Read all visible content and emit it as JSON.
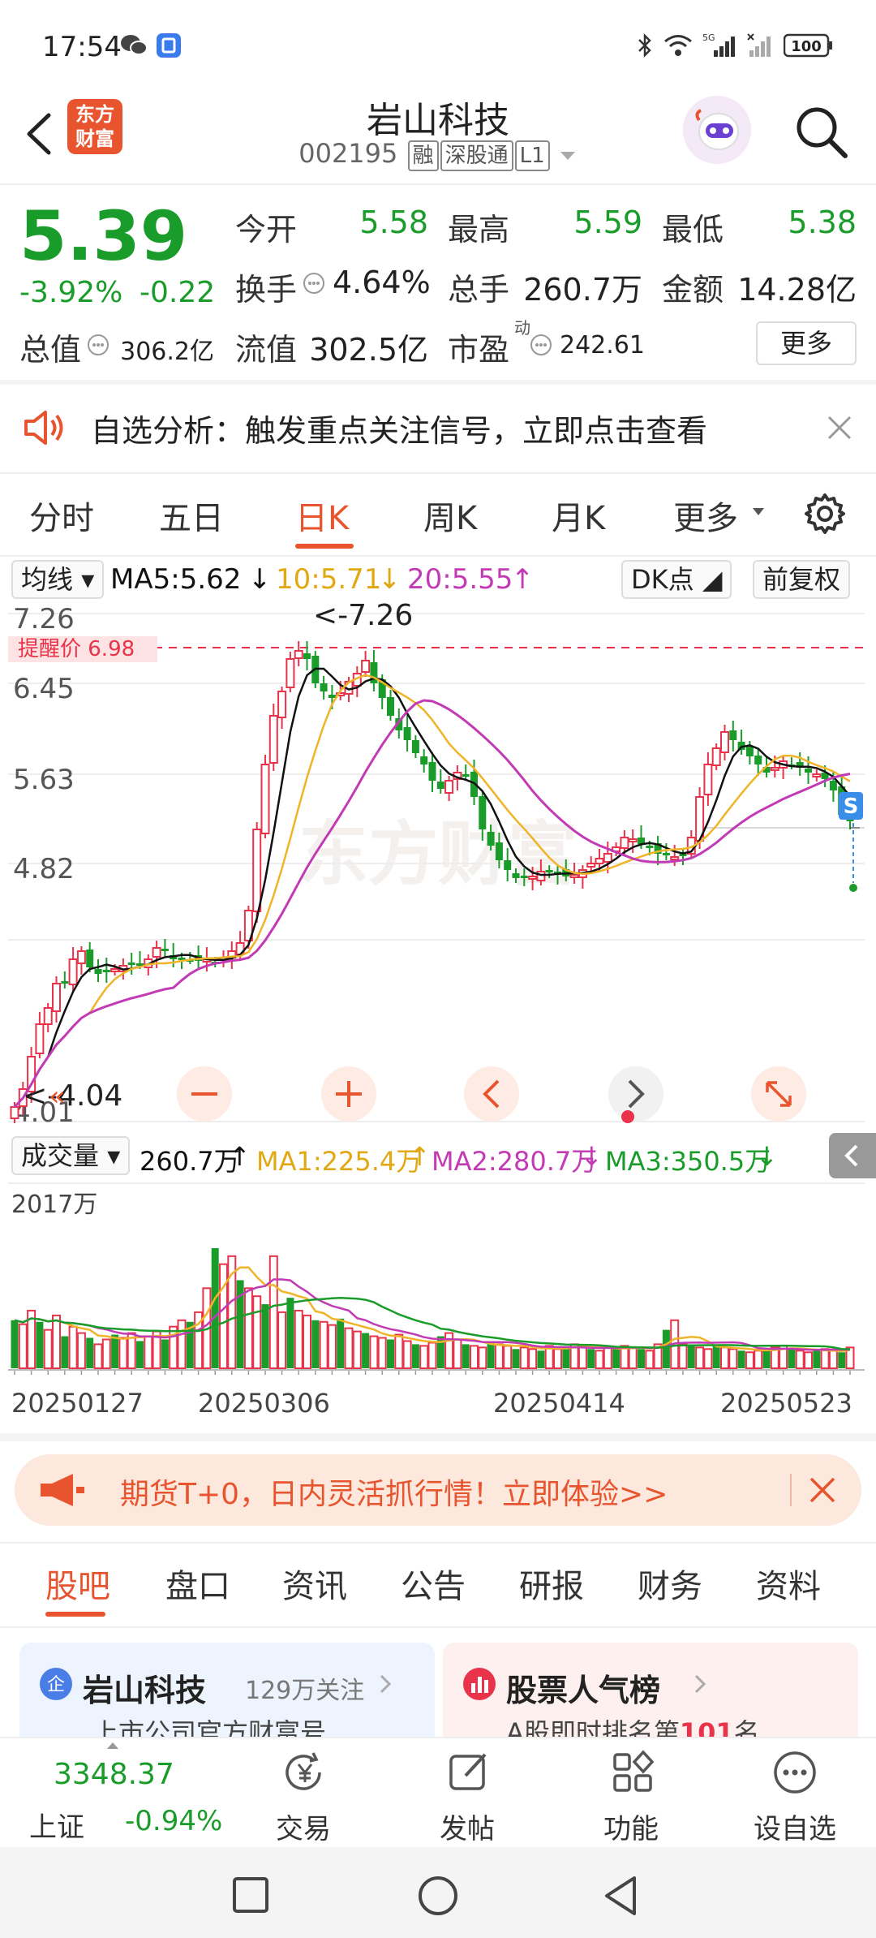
{
  "status_bar": {
    "time": "17:54",
    "battery": "100"
  },
  "nav": {
    "stock_name": "岩山科技",
    "code": "002195",
    "tags": [
      "融",
      "深股通",
      "L1"
    ],
    "logo_line1": "东方",
    "logo_line2": "财富"
  },
  "quote": {
    "price": "5.39",
    "change_pct": "-3.92%",
    "change_abs": "-0.22",
    "open_label": "今开",
    "open": "5.58",
    "high_label": "最高",
    "high": "5.59",
    "low_label": "最低",
    "low": "5.38",
    "turnover_label": "换手",
    "turnover": "4.64%",
    "volume_label": "总手",
    "volume": "260.7万",
    "amount_label": "金额",
    "amount": "14.28亿",
    "mktcap_label": "总值",
    "mktcap": "306.2亿",
    "float_label": "流值",
    "float_cap": "302.5亿",
    "pe_label": "市盈",
    "pe_sup": "动",
    "pe": "242.61",
    "more": "更多"
  },
  "alert": {
    "text": "自选分析：触发重点关注信号，立即点击查看"
  },
  "period_tabs": [
    "分时",
    "五日",
    "日K",
    "周K",
    "月K",
    "更多"
  ],
  "active_period": "日K",
  "ma_row": {
    "selector": "均线",
    "ma5": "MA5:5.62",
    "ma10": "10:5.71",
    "ma20": "20:5.55",
    "dk": "DK点",
    "adjust": "前复权"
  },
  "chart": {
    "y_labels": [
      "7.26",
      "6.45",
      "5.63",
      "4.82",
      "4.01"
    ],
    "max_marker": "<-7.26",
    "min_marker": "<-4.04",
    "alert_price": "提醒价 6.98",
    "watermark": "东方财富",
    "sell_marker": "S",
    "colors": {
      "up": "#e8334a",
      "down": "#1a9c2b",
      "ma5": "#111111",
      "ma10": "#f0b429",
      "ma20": "#c23bb5"
    }
  },
  "vol_row": {
    "selector": "成交量",
    "vol": "260.7万",
    "ma1": "MA1:225.4万",
    "ma2": "MA2:280.7万",
    "ma3": "MA3:350.5万",
    "max_label": "2017万"
  },
  "dates": [
    "20250127",
    "20250306",
    "20250414",
    "20250523"
  ],
  "promo": {
    "text": "期货T+0，日内灵活抓行情！立即体验>>"
  },
  "section_tabs": [
    "股吧",
    "盘口",
    "资讯",
    "公告",
    "研报",
    "财务",
    "资料"
  ],
  "cards": [
    {
      "title": "岩山科技",
      "extra": "129万关注",
      "sub": "上市公司官方财富号",
      "badge": "企"
    },
    {
      "title": "股票人气榜",
      "sub_prefix": "A股即时排名第",
      "rank": "101",
      "sub_suffix": "名"
    }
  ],
  "bottom_bar": {
    "index_value": "3348.37",
    "index_name": "上证",
    "index_change": "-0.94%",
    "items": [
      "交易",
      "发帖",
      "功能",
      "设自选"
    ]
  }
}
